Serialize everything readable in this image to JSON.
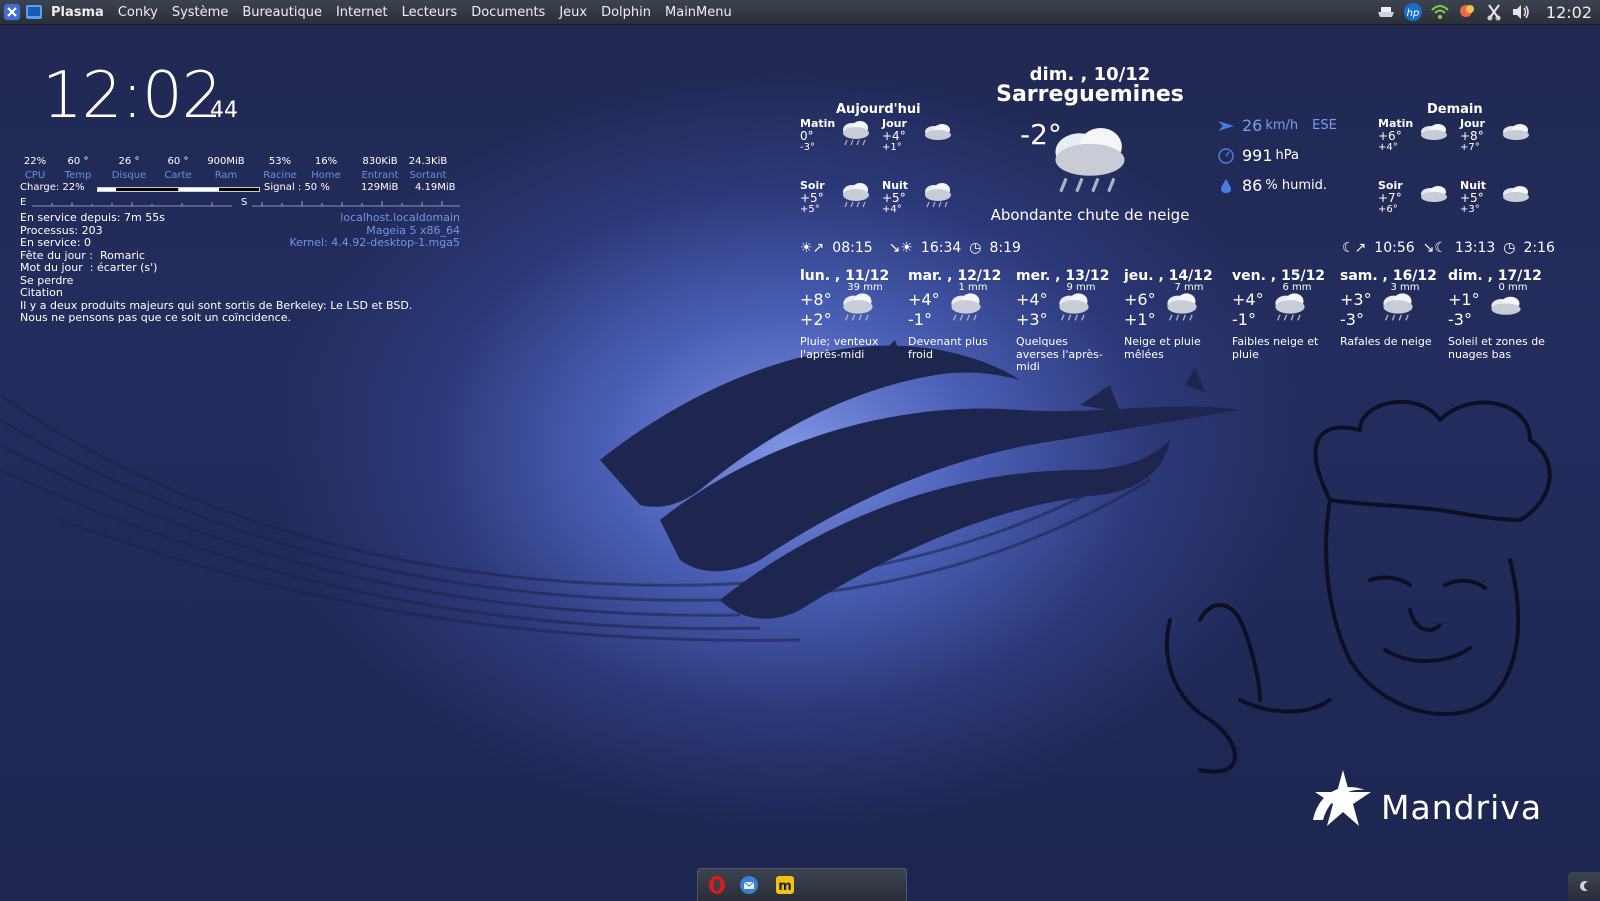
{
  "topbar": {
    "menu": [
      "Plasma",
      "Conky",
      "Système",
      "Bureautique",
      "Internet",
      "Lecteurs",
      "Documents",
      "Jeux",
      "Dolphin",
      "MainMenu"
    ],
    "clock": "12:02",
    "tray_icons": [
      "printer-icon",
      "hp-icon",
      "wifi-icon",
      "notification-icon",
      "klipper-icon",
      "volume-icon"
    ]
  },
  "conky": {
    "time": "12:02",
    "seconds": "44",
    "stats": [
      {
        "value": "22%",
        "label": "CPU"
      },
      {
        "value": "60 °",
        "label": "Temp"
      },
      {
        "value": "26 °",
        "label": "Disque"
      },
      {
        "value": "60 °",
        "label": "Carte"
      },
      {
        "value": "900MiB",
        "label": "Ram"
      },
      {
        "value": "53%",
        "label": "Racine"
      },
      {
        "value": "16%",
        "label": "Home"
      },
      {
        "value": "830KiB",
        "label": "Entrant"
      },
      {
        "value": "24.3KiB",
        "label": "Sortant"
      }
    ],
    "charge_label": "Charge: 22%",
    "charge_level": 0.22,
    "signal_label": "Signal : 50 %",
    "signal_level": 0.5,
    "in_total": "129MiB",
    "out_total": "4.19MiB",
    "e_label": "E",
    "s_label": "S",
    "info_lines": [
      "En service depuis: 7m 55s",
      "Processus: 203",
      "En service: 0",
      "Fête du jour :  Romaric",
      "Mot du jour  : écarter (s')",
      "Se perdre",
      "Citation",
      "Il y a deux produits majeurs qui sont sortis de Berkeley: Le LSD et BSD.",
      "Nous ne pensons pas que ce soit un coïncidence."
    ],
    "host": "localhost.localdomain",
    "os": "Mageia 5 x86_64",
    "kernel": "Kernel: 4.4.92-desktop-1.mga5"
  },
  "weather": {
    "date": "dim. , 10/12",
    "city": "Sarreguemines",
    "current_temp": "-2°",
    "current_desc": "Abondante chute de neige",
    "today_title": "Aujourd'hui",
    "tomorrow_title": "Demain",
    "today": [
      {
        "name": "Matin",
        "hi": "0°",
        "lo": "-3°"
      },
      {
        "name": "Jour",
        "hi": "+4°",
        "lo": "+1°"
      },
      {
        "name": "Soir",
        "hi": "+5°",
        "lo": "+5°"
      },
      {
        "name": "Nuit",
        "hi": "+5°",
        "lo": "+4°"
      }
    ],
    "tomorrow": [
      {
        "name": "Matin",
        "hi": "+6°",
        "lo": "+4°"
      },
      {
        "name": "Jour",
        "hi": "+8°",
        "lo": "+7°"
      },
      {
        "name": "Soir",
        "hi": "+7°",
        "lo": "+6°"
      },
      {
        "name": "Nuit",
        "hi": "+5°",
        "lo": "+3°"
      }
    ],
    "wind_speed": "26",
    "wind_unit": "km/h",
    "wind_dir": "ESE",
    "pressure": "991",
    "pressure_unit": "hPa",
    "humidity": "86",
    "humidity_unit": "% humid.",
    "sunrise": "08:15",
    "sunset": "16:34",
    "daylength": "8:19",
    "moonrise": "10:56",
    "moonset": "13:13",
    "moonlength": "2:16",
    "forecast": [
      {
        "day": "lun. , 11/12",
        "mm": "39 mm",
        "hi": "+8°",
        "lo": "+2°",
        "desc": "Pluie; venteux l'après-midi"
      },
      {
        "day": "mar. , 12/12",
        "mm": "1 mm",
        "hi": "+4°",
        "lo": "-1°",
        "desc": "Devenant plus froid"
      },
      {
        "day": "mer. , 13/12",
        "mm": "9 mm",
        "hi": "+4°",
        "lo": "+3°",
        "desc": "Quelques averses l'après-midi"
      },
      {
        "day": "jeu. , 14/12",
        "mm": "7 mm",
        "hi": "+6°",
        "lo": "+1°",
        "desc": "Neige et pluie mêlées"
      },
      {
        "day": "ven. , 15/12",
        "mm": "6 mm",
        "hi": "+4°",
        "lo": "-1°",
        "desc": "Faibles neige et pluie"
      },
      {
        "day": "sam. , 16/12",
        "mm": "3 mm",
        "hi": "+3°",
        "lo": "-3°",
        "desc": "Rafales de neige"
      },
      {
        "day": "dim. , 17/12",
        "mm": "0 mm",
        "hi": "+1°",
        "lo": "-3°",
        "desc": "Soleil et zones de nuages bas"
      }
    ]
  },
  "wallpaper": {
    "logo_text": "Mandriva"
  },
  "taskbar": {
    "apps": [
      "opera-icon",
      "thunderbird-icon",
      "mageia-update-icon"
    ]
  },
  "colors": {
    "accent_blue": "#5f95e0",
    "panel": "#2a2f39"
  }
}
